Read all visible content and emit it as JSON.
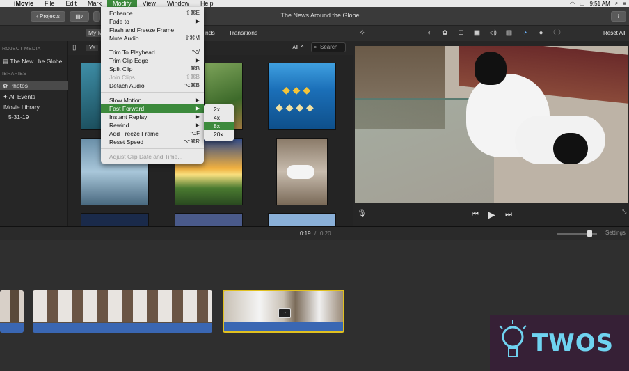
{
  "menubar": {
    "app": "iMovie",
    "items": [
      "File",
      "Edit",
      "Mark",
      "Modify",
      "View",
      "Window",
      "Help"
    ],
    "active": "Modify",
    "clock": "9:51 AM"
  },
  "titlebar": {
    "projects_label": "Projects",
    "title": "The News Around the Globe"
  },
  "tabs": {
    "my_media": "My M",
    "sounds": "nds",
    "transitions": "Transitions"
  },
  "viewer_tools": {
    "reset_all": "Reset All"
  },
  "sidebar": {
    "project_media_header": "ROJECT MEDIA",
    "project_item": "The New...he Globe",
    "libraries_header": "IBRARIES",
    "photos": "Photos",
    "all_events": "All Events",
    "library": "iMovie Library",
    "date": "5-31-19"
  },
  "browser": {
    "year_label": "Ye",
    "filter": "All",
    "search_placeholder": "Search"
  },
  "menu": {
    "items": [
      {
        "label": "Enhance",
        "shortcut": "⇧⌘E"
      },
      {
        "label": "Fade to",
        "shortcut": "▶"
      },
      {
        "label": "Flash and Freeze Frame",
        "shortcut": ""
      },
      {
        "label": "Mute Audio",
        "shortcut": "⇧⌘M"
      },
      {
        "label": "Trim To Playhead",
        "shortcut": "⌥/"
      },
      {
        "label": "Trim Clip Edge",
        "shortcut": "▶"
      },
      {
        "label": "Split Clip",
        "shortcut": "⌘B"
      },
      {
        "label": "Join Clips",
        "shortcut": "⇧⌘B"
      },
      {
        "label": "Detach Audio",
        "shortcut": "⌥⌘B"
      },
      {
        "label": "Slow Motion",
        "shortcut": "▶"
      },
      {
        "label": "Fast Forward",
        "shortcut": "▶"
      },
      {
        "label": "Instant Replay",
        "shortcut": "▶"
      },
      {
        "label": "Rewind",
        "shortcut": "▶"
      },
      {
        "label": "Add Freeze Frame",
        "shortcut": "⌥F"
      },
      {
        "label": "Reset Speed",
        "shortcut": "⌥⌘R"
      },
      {
        "label": "Adjust Clip Date and Time...",
        "shortcut": ""
      }
    ],
    "submenu": [
      "2x",
      "4x",
      "8x",
      "20x"
    ]
  },
  "timeline": {
    "current": "0:19",
    "separator": "/",
    "total": "0:20",
    "settings": "Settings"
  },
  "watermark": {
    "text": "TWOS"
  },
  "colors": {
    "menu_highlight": "#3c8a3c",
    "audio_bar": "#3a67b3",
    "selected_clip_border": "#e0c020"
  }
}
